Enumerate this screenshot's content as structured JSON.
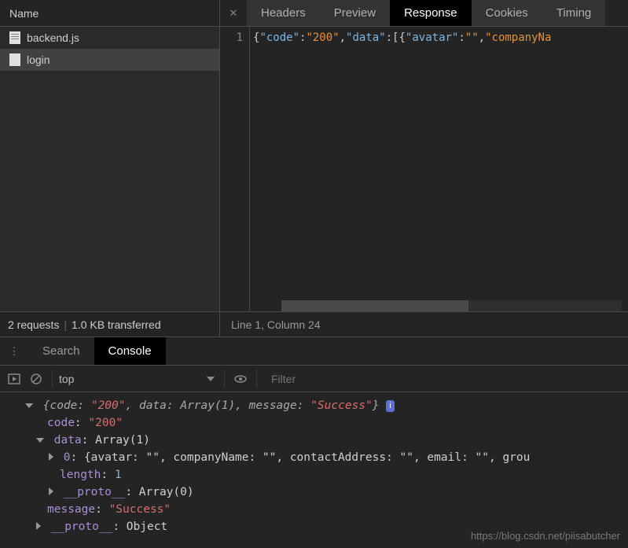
{
  "sidebar": {
    "header": "Name",
    "items": [
      {
        "label": "backend.js"
      },
      {
        "label": "login"
      }
    ]
  },
  "tabs": {
    "items": [
      "Headers",
      "Preview",
      "Response",
      "Cookies",
      "Timing"
    ]
  },
  "response": {
    "line_number": "1",
    "tokens": {
      "key_code": "\"code\"",
      "val_code": "\"200\"",
      "key_data": "\"data\"",
      "key_avatar": "\"avatar\"",
      "val_avatar": "\"\"",
      "key_company": "\"companyNa"
    }
  },
  "status": {
    "requests": "2 requests",
    "transferred": "1.0 KB transferred",
    "cursor": "Line 1, Column 24"
  },
  "drawer": {
    "tabs": [
      "Search",
      "Console"
    ]
  },
  "console_toolbar": {
    "context": "top",
    "filter_placeholder": "Filter"
  },
  "console": {
    "line1_italic": "{code: ",
    "line1_code": "\"200\"",
    "line1_rest": ", data: Array(1), message: ",
    "line1_msg": "\"Success\"",
    "line1_close": "}",
    "badge": "i",
    "code_key": "code",
    "code_val": "\"200\"",
    "data_key": "data",
    "data_val": "Array(1)",
    "idx0_key": "0",
    "idx0_val": "{avatar: \"\", companyName: \"\", contactAddress: \"\", email: \"\", grou",
    "length_key": "length",
    "length_val": "1",
    "proto1_key": "__proto__",
    "proto1_val": "Array(0)",
    "message_key": "message",
    "message_val": "\"Success\"",
    "proto2_key": "__proto__",
    "proto2_val": "Object"
  },
  "watermark": "https://blog.csdn.net/piisabutcher"
}
